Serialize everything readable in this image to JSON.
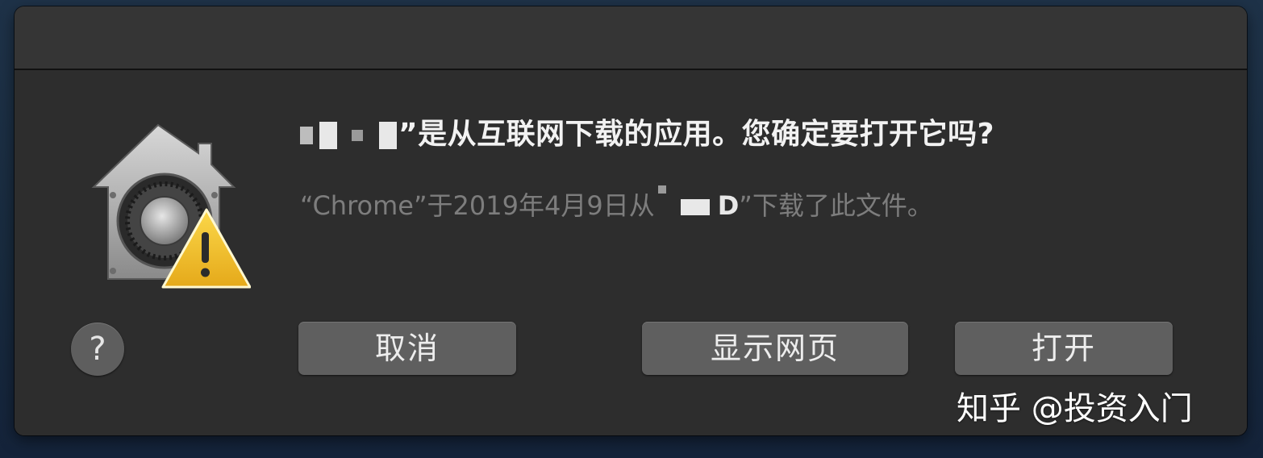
{
  "dialog": {
    "title_text": "”是从互联网下载的应用。您确定要打开它吗?",
    "subtitle_prefix": "“Chrome”于2019年4月9日从",
    "subtitle_mid": "D",
    "subtitle_suffix": "”下载了此文件。",
    "icon": "gatekeeper-warning-icon"
  },
  "help": {
    "label": "?"
  },
  "buttons": {
    "cancel": "取消",
    "show_page": "显示网页",
    "open": "打开"
  },
  "watermark": {
    "text": "知乎 @投资入门"
  },
  "colors": {
    "dialog_bg": "#2d2d2d",
    "button_bg": "#5f5f5f",
    "warning_yellow": "#f2c230"
  }
}
